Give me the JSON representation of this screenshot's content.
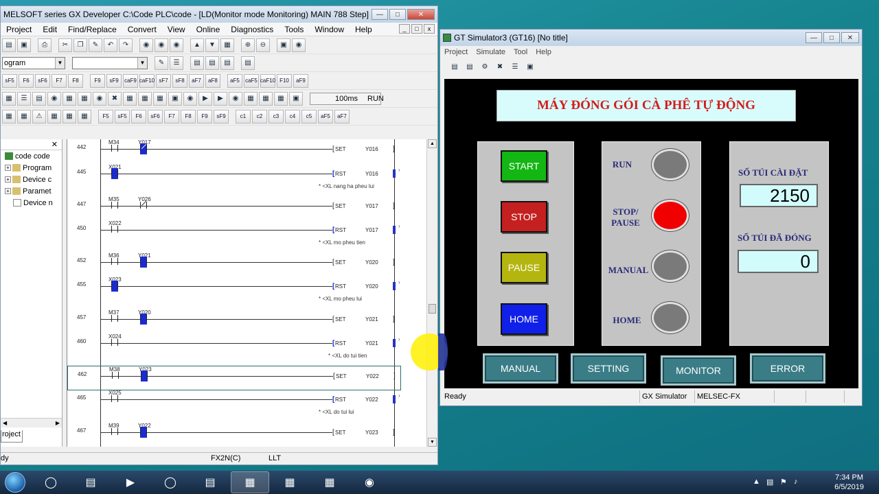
{
  "gx": {
    "title": "MELSOFT series GX Developer C:\\Code PLC\\code - [LD(Monitor mode Monitoring)    MAIN    788 Step]",
    "menu": [
      "Project",
      "Edit",
      "Find/Replace",
      "Convert",
      "View",
      "Online",
      "Diagnostics",
      "Tools",
      "Window",
      "Help"
    ],
    "combo1": "ogram",
    "scan_time": "100ms",
    "run_state": "RUN",
    "fkeys_row3": [
      "sF5",
      "F6",
      "sF6",
      "F7",
      "F8",
      "F9",
      "sF9",
      "caF9",
      "caF10",
      "sF7",
      "sF8",
      "aF7",
      "aF8",
      "aF5",
      "caF5",
      "caF10",
      "F10",
      "aF9"
    ],
    "fkeys_row5": [
      "F5",
      "sF5",
      "F6",
      "sF6",
      "F7",
      "F8",
      "F9",
      "sF9",
      "c1",
      "c2",
      "c3",
      "c4",
      "c5",
      "aF5",
      "aF7"
    ],
    "tree": {
      "root": "code code",
      "items": [
        "Program",
        "Device c",
        "Paramet",
        "Device n"
      ],
      "tab": "roject"
    },
    "ladder": [
      {
        "step": "442",
        "c1": "M34",
        "c2": "Y017",
        "c2_on": true,
        "c2_nc": true,
        "ins": "SET",
        "op": "Y016",
        "coil_on": false,
        "comment": ""
      },
      {
        "step": "445",
        "c1": "X021",
        "c1_on": true,
        "ins": "RST",
        "op": "Y016",
        "coil_on": true,
        "comment": "* <XL nang ha pheu lui"
      },
      {
        "step": "447",
        "c1": "M35",
        "c2": "Y026",
        "c2_nc": true,
        "ins": "SET",
        "op": "Y017",
        "comment": ""
      },
      {
        "step": "450",
        "c1": "X022",
        "ins": "RST",
        "op": "Y017",
        "coil_on": true,
        "comment": "* <XL mo pheu tien"
      },
      {
        "step": "452",
        "c1": "M36",
        "c2": "Y021",
        "c2_on": true,
        "ins": "SET",
        "op": "Y020",
        "comment": ""
      },
      {
        "step": "455",
        "c1": "X023",
        "c1_on": true,
        "ins": "RST",
        "op": "Y020",
        "coil_on": true,
        "comment": "* <XL mo pheu lui"
      },
      {
        "step": "457",
        "c1": "M37",
        "c2": "Y020",
        "c2_on": true,
        "ins": "SET",
        "op": "Y021",
        "comment": ""
      },
      {
        "step": "460",
        "c1": "X024",
        "ins": "RST",
        "op": "Y021",
        "coil_on": true,
        "comment": "* <XL do tui tien"
      },
      {
        "step": "462",
        "c1": "M38",
        "c2": "Y023",
        "c2_on": true,
        "ins": "SET",
        "op": "Y022",
        "comment": ""
      },
      {
        "step": "465",
        "c1": "X025",
        "ins": "RST",
        "op": "Y022",
        "coil_on": true,
        "comment": "* <XL do tui lui"
      },
      {
        "step": "467",
        "c1": "M39",
        "c2": "Y022",
        "c2_on": true,
        "ins": "SET",
        "op": "Y023",
        "comment": ""
      }
    ],
    "status": {
      "left": "dy",
      "cpu": "FX2N(C)",
      "mode": "LLT"
    }
  },
  "gt": {
    "title": "GT Simulator3 (GT16)   [No title]",
    "menu": [
      "Project",
      "Simulate",
      "Tool",
      "Help"
    ],
    "hmi_title": "MÁY ĐÓNG GÓI CÀ PHÊ TỰ ĐỘNG",
    "buttons": [
      {
        "label": "START",
        "color": "#13b613"
      },
      {
        "label": "STOP",
        "color": "#c42020"
      },
      {
        "label": "PAUSE",
        "color": "#b5b510"
      },
      {
        "label": "HOME",
        "color": "#1020e8"
      }
    ],
    "lamps": [
      {
        "label": "RUN",
        "color": "#7a7a7a"
      },
      {
        "label": "STOP/\nPAUSE",
        "color": "#f00000"
      },
      {
        "label": "MANUAL",
        "color": "#7a7a7a"
      },
      {
        "label": "HOME",
        "color": "#7a7a7a"
      }
    ],
    "setpoint_label": "SỐ TÚI CÀI ĐẶT",
    "setpoint_value": "2150",
    "packed_label": "SỐ TÚI ĐÃ ĐÓNG",
    "packed_value": "0",
    "nav": [
      "MANUAL",
      "SETTING",
      "MONITOR",
      "ERROR"
    ],
    "status": {
      "left": "Ready",
      "sim": "GX Simulator",
      "plc": "MELSEC-FX"
    }
  },
  "taskbar": {
    "time": "7:34 PM",
    "date": "6/5/2019"
  }
}
